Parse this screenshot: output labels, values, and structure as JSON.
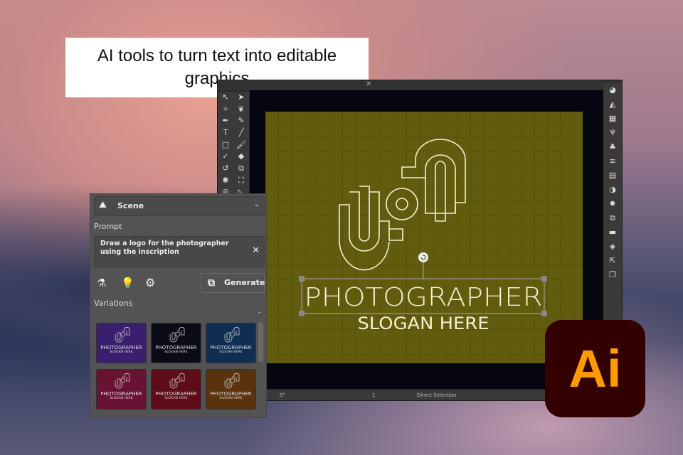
{
  "headline": "AI tools to turn text into editable graphics",
  "colors": {
    "artboard": "#625d0e",
    "ai_bg": "#330000",
    "ai_text": "#ff9a00"
  },
  "logo": {
    "title": "PHOTOGRAPHER",
    "slogan": "SLOGAN HERE"
  },
  "status_bar": {
    "angle": "0°",
    "page": "1",
    "tool": "Direct Selection"
  },
  "scene_panel": {
    "dropdown": "Scene",
    "prompt_label": "Prompt",
    "prompt_text": "Draw a logo for the photographer using the inscription",
    "generate": "Generate",
    "variations_label": "Variations",
    "variations": [
      {
        "color": "#3a1f6e",
        "title": "PHOTOGRAPHER",
        "slogan": "SLOGAN HERE"
      },
      {
        "color": "#0b0b16",
        "title": "PHOTOGRAPHER",
        "slogan": "SLOGAN HERE"
      },
      {
        "color": "#0f2e52",
        "title": "PHOTOGRAPHER",
        "slogan": "SLOGAN HERE"
      },
      {
        "color": "#6a1234",
        "title": "PHOTOGRAPHER",
        "slogan": "SLOGAN HERE"
      },
      {
        "color": "#5e0c18",
        "title": "PHOTOGRAPHER",
        "slogan": "SLOGAN HERE"
      },
      {
        "color": "#5a320e",
        "title": "PHOTOGRAPHER",
        "slogan": "SLOGAN HERE"
      }
    ]
  },
  "app_logo": "Ai"
}
